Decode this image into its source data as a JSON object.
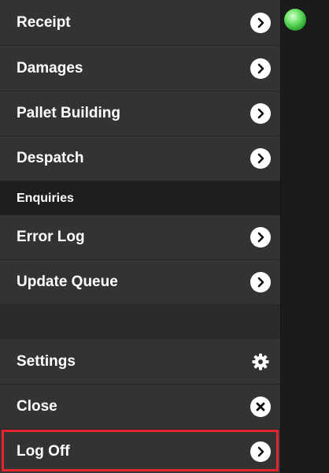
{
  "menu": {
    "receipt": "Receipt",
    "damages": "Damages",
    "pallet_building": "Pallet Building",
    "despatch": "Despatch",
    "enquiries_header": "Enquiries",
    "error_log": "Error Log",
    "update_queue": "Update Queue",
    "settings": "Settings",
    "close": "Close",
    "log_off": "Log Off"
  },
  "icons": {
    "chevron": "chevron-right-icon",
    "settings": "gear-icon",
    "close": "close-icon",
    "status": "status-light-icon"
  },
  "colors": {
    "highlight_border": "#e3252d",
    "status_green": "#4cc44a"
  }
}
